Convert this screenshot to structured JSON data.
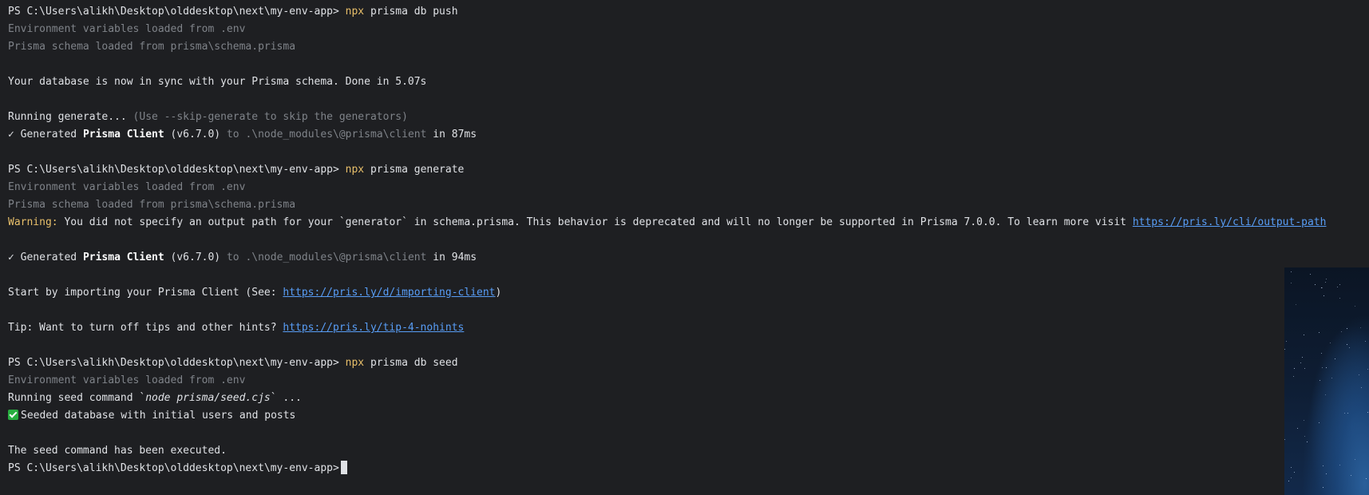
{
  "prompt": "PS C:\\Users\\alikh\\Desktop\\olddesktop\\next\\my-env-app>",
  "commands": {
    "push": {
      "exe": "npx",
      "args": "prisma db push"
    },
    "generate": {
      "exe": "npx",
      "args": "prisma generate"
    },
    "seed": {
      "exe": "npx",
      "args": "prisma db seed"
    }
  },
  "output": {
    "env_loaded": "Environment variables loaded from .env",
    "schema_loaded": "Prisma schema loaded from prisma\\schema.prisma",
    "in_sync": "Your database is now in sync with your Prisma schema. Done in 5.07s",
    "running_generate": "Running generate...",
    "running_generate_hint": "(Use --skip-generate to skip the generators)",
    "check_mark": "✓",
    "generated_word": "Generated",
    "client_name": "Prisma Client",
    "client_version": "(v6.7.0)",
    "to_word": "to",
    "client_path": ".\\node_modules\\@prisma\\client",
    "time_1": "in 87ms",
    "time_2": "in 94ms",
    "warning_label": "Warning:",
    "warning_text": "You did not specify an output path for your `generator` in schema.prisma. This behavior is deprecated and will no longer be supported in Prisma 7.0.0. To learn more visit",
    "warning_link": "https://pris.ly/cli/output-path",
    "import_text": "Start by importing your Prisma Client (See:",
    "import_link": "https://pris.ly/d/importing-client",
    "import_close": ")",
    "tip_text": "Tip: Want to turn off tips and other hints?",
    "tip_link": "https://pris.ly/tip-4-nohints",
    "seed_cmd_prefix": "Running seed command `",
    "seed_cmd_italic": "node prisma/seed.cjs",
    "seed_cmd_suffix": "` ...",
    "seeded_text": "Seeded database with initial users and posts",
    "seed_executed": "The seed command has been executed."
  },
  "colors": {
    "background": "#1e1f22",
    "text": "#dfe1e5",
    "dim": "#7f8389",
    "accent_yellow": "#e8bf6a",
    "link": "#589df6",
    "emoji_green": "#27ae3f"
  }
}
